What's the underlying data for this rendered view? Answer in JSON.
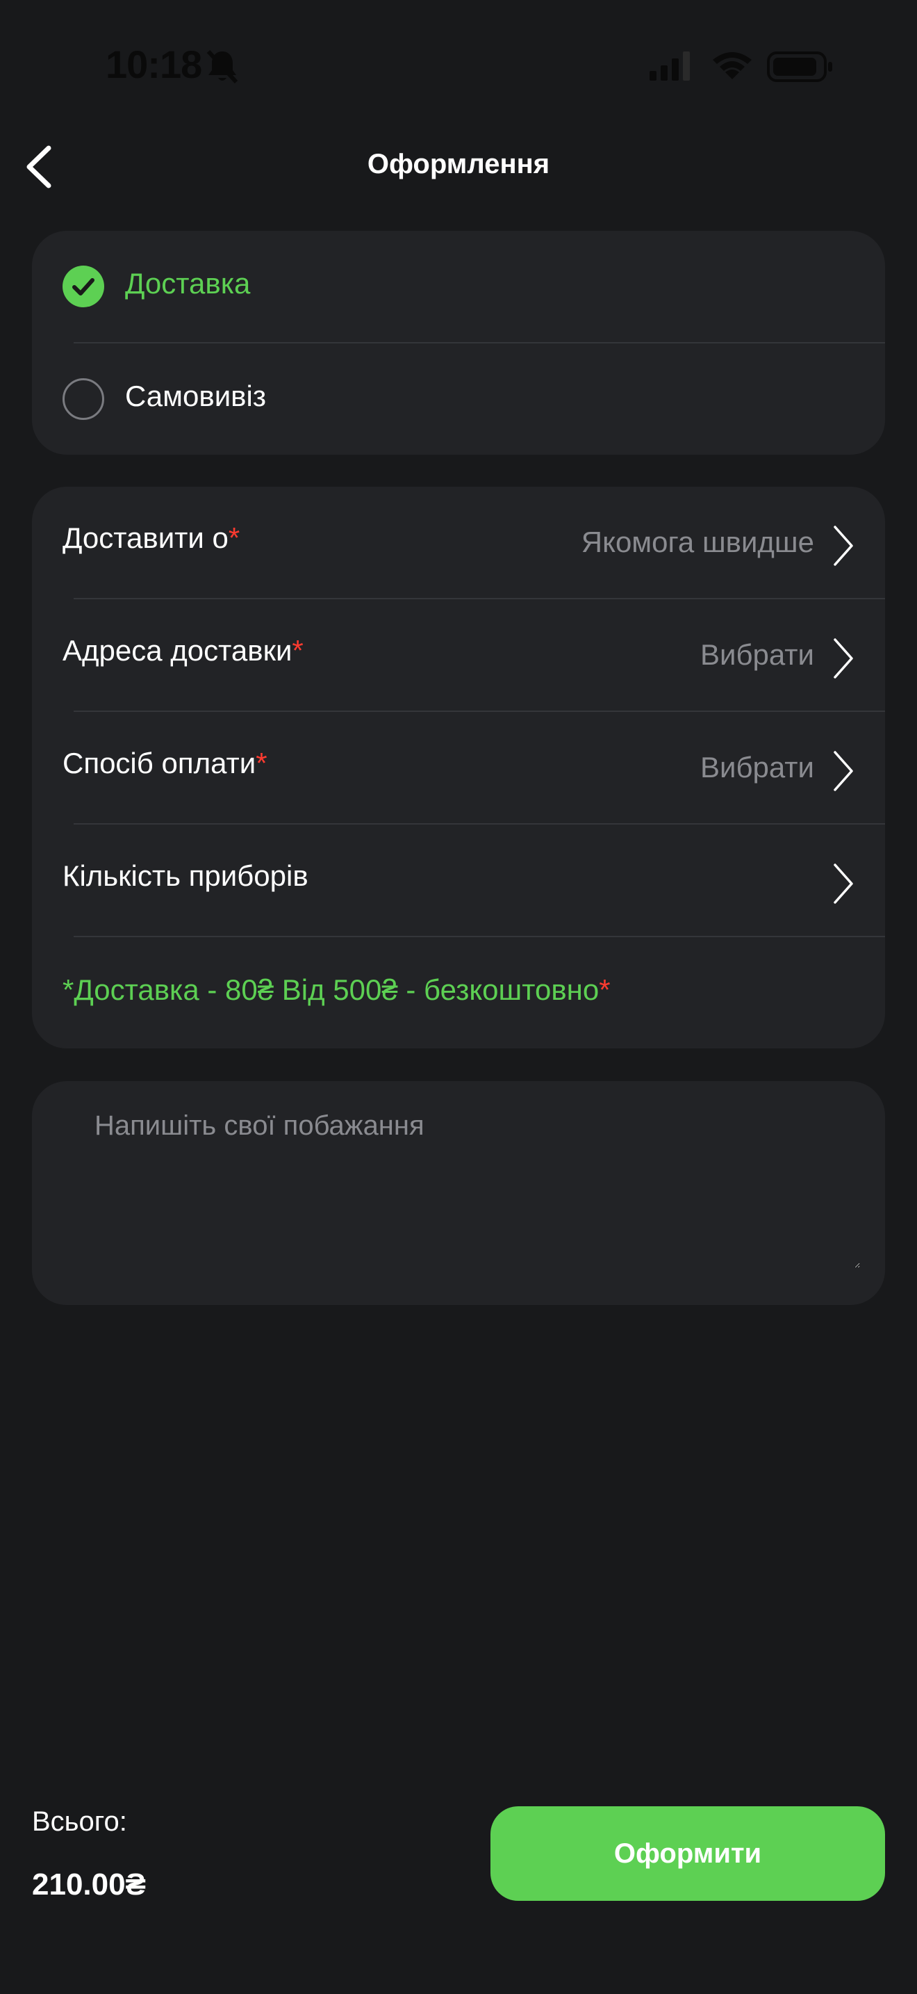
{
  "status_bar": {
    "time": "10:18"
  },
  "nav": {
    "title": "Оформлення"
  },
  "delivery_options": [
    {
      "label": "Доставка",
      "selected": true
    },
    {
      "label": "Самовивіз",
      "selected": false
    }
  ],
  "fields": {
    "time": {
      "label": "Доставити о",
      "required_mark": "*",
      "value": "Якомога швидше"
    },
    "address": {
      "label": "Адреса доставки",
      "required_mark": "*",
      "value": "Вибрати"
    },
    "payment": {
      "label": "Спосіб оплати",
      "required_mark": "*",
      "value": "Вибрати"
    },
    "cutlery": {
      "label": "Кількість приборів"
    }
  },
  "delivery_note": {
    "text": "*Доставка - 80₴ Від 500₴ - безкоштовно",
    "mark": "*"
  },
  "wishes": {
    "placeholder": "Напишіть свої побажання"
  },
  "footer": {
    "total_label": "Всього:",
    "total_value": "210.00₴",
    "submit_label": "Оформити"
  },
  "colors": {
    "accent": "#5dd053",
    "background": "#18191b",
    "card": "#222326",
    "required": "#ff3b30"
  }
}
